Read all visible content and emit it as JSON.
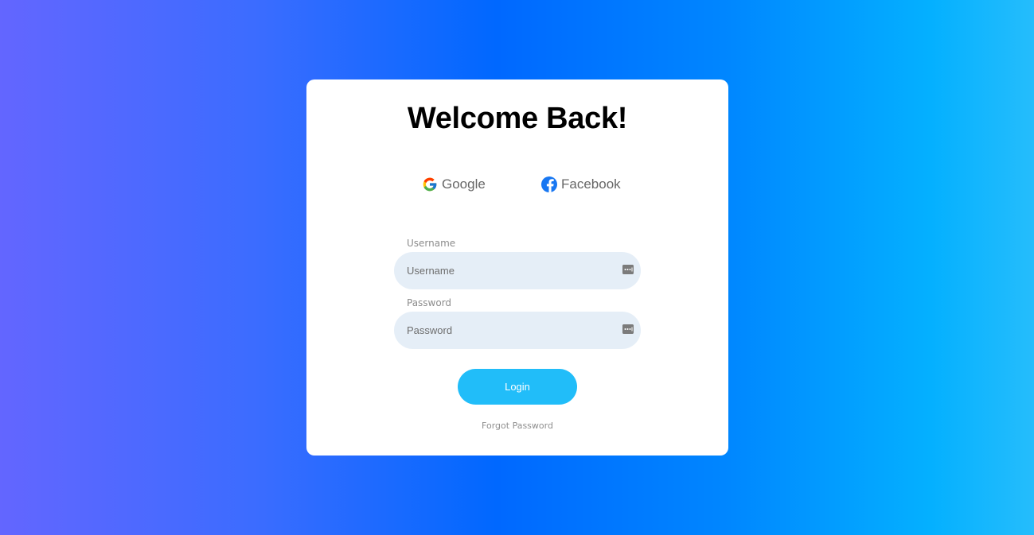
{
  "card": {
    "title": "Welcome Back!"
  },
  "social": {
    "google": {
      "label": "Google",
      "icon": "google-icon"
    },
    "facebook": {
      "label": "Facebook",
      "icon": "facebook-icon"
    }
  },
  "form": {
    "username": {
      "label": "Username",
      "placeholder": "Username",
      "value": ""
    },
    "password": {
      "label": "Password",
      "placeholder": "Password",
      "value": ""
    },
    "login_label": "Login",
    "forgot_label": "Forgot Password"
  },
  "colors": {
    "background_gradient": [
      "#6366ff",
      "#0068ff",
      "#25bdfc"
    ],
    "card": "#ffffff",
    "field_bg": "#e5eef7",
    "login_button": "#21bdf9",
    "facebook_blue": "#1877f2"
  }
}
